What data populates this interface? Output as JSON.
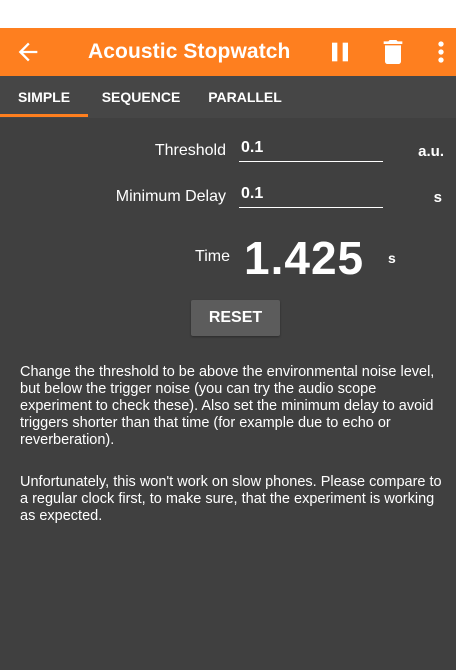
{
  "app_bar": {
    "title": "Acoustic Stopwatch",
    "background_color": "#fe7f1f",
    "icons": [
      "back-arrow-icon",
      "pause-icon",
      "trash-icon",
      "more-vert-icon"
    ]
  },
  "tabs": [
    {
      "label": "SIMPLE",
      "selected": true
    },
    {
      "label": "SEQUENCE",
      "selected": false
    },
    {
      "label": "PARALLEL",
      "selected": false
    }
  ],
  "form": {
    "threshold": {
      "label": "Threshold",
      "value": "0.1",
      "unit": "a.u."
    },
    "minimum_delay": {
      "label": "Minimum Delay",
      "value": "0.1",
      "unit": "s"
    }
  },
  "time": {
    "label": "Time",
    "value": "1.425",
    "unit": "s"
  },
  "reset_label": "RESET",
  "description": [
    "Change the threshold to be above the environmental noise level, but below the trigger noise (you can try the audio scope experiment to check these). Also set the minimum delay to avoid triggers shorter than that time (for example due to echo or reverberation).",
    "Unfortunately, this won't work on slow phones. Please compare to a regular clock first, to make sure, that the experiment is working as expected."
  ],
  "colors": {
    "background": "#404040",
    "tab_bar": "#464646",
    "accent": "#fe7f1f",
    "button": "#5c5c5c"
  }
}
